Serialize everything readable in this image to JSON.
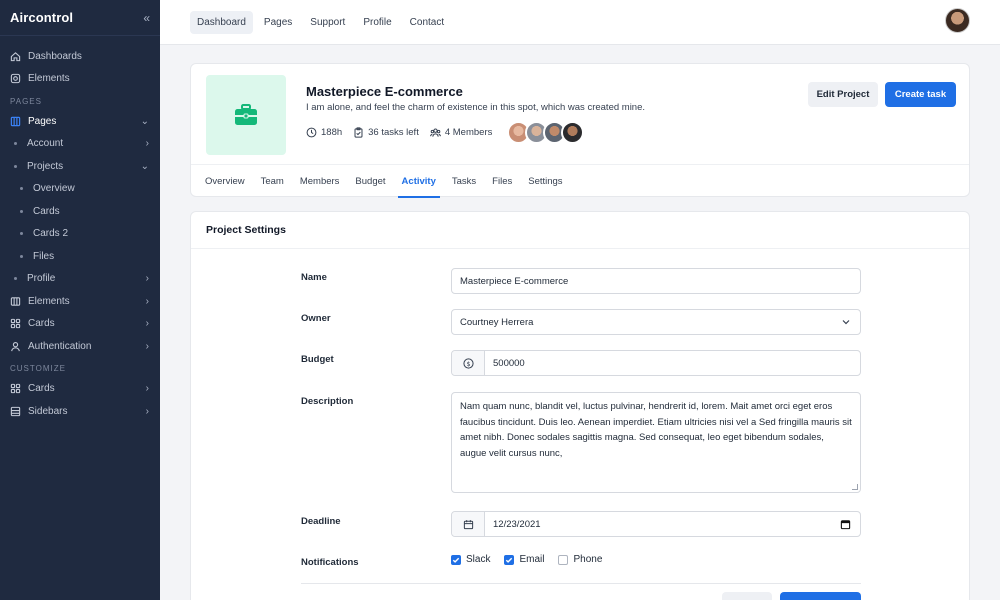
{
  "app": {
    "name": "Aircontrol",
    "collapse_icon": "double-chevron-left-icon"
  },
  "sidebar": {
    "sections": {
      "pages": "PAGES",
      "customize": "CUSTOMIZE"
    },
    "items": [
      {
        "label": "Dashboards",
        "icon": "home-icon"
      },
      {
        "label": "Elements",
        "icon": "settings-icon"
      },
      {
        "label": "Pages",
        "icon": "layout-icon"
      },
      {
        "label": "Account"
      },
      {
        "label": "Projects"
      },
      {
        "label": "Overview"
      },
      {
        "label": "Cards"
      },
      {
        "label": "Cards 2"
      },
      {
        "label": "Files"
      },
      {
        "label": "Profile"
      },
      {
        "label": "Elements",
        "icon": "columns-icon"
      },
      {
        "label": "Cards",
        "icon": "grid-icon"
      },
      {
        "label": "Authentication",
        "icon": "user-icon"
      },
      {
        "label": "Cards",
        "icon": "grid-icon"
      },
      {
        "label": "Sidebars",
        "icon": "sidebar-icon"
      }
    ]
  },
  "topnav": [
    "Dashboard",
    "Pages",
    "Support",
    "Profile",
    "Contact"
  ],
  "project": {
    "title": "Masterpiece E-commerce",
    "subtitle": "I am alone, and feel the charm of existence in this spot, which was created mine.",
    "hours": "188h",
    "tasks_left": "36 tasks left",
    "members": "4 Members",
    "edit_label": "Edit Project",
    "create_label": "Create task",
    "colors": {
      "accent": "#1f6fe5",
      "thumb_bg": "#dcf8ec",
      "icon": "#14b879"
    }
  },
  "tabs": [
    "Overview",
    "Team",
    "Members",
    "Budget",
    "Activity",
    "Tasks",
    "Files",
    "Settings"
  ],
  "active_tab": "Activity",
  "settings": {
    "title": "Project Settings",
    "name_label": "Name",
    "name_value": "Masterpiece E-commerce",
    "owner_label": "Owner",
    "owner_value": "Courtney Herrera",
    "budget_label": "Budget",
    "budget_value": "500000",
    "description_label": "Description",
    "description_value": "Nam quam nunc, blandit vel, luctus pulvinar, hendrerit id, lorem. Mait amet orci eget eros faucibus tincidunt. Duis leo. Aenean imperdiet. Etiam ultricies nisi vel a Sed fringilla mauris sit amet nibh. Donec sodales sagittis magna. Sed consequat, leo eget bibendum sodales, augue velit cursus nunc,",
    "deadline_label": "Deadline",
    "deadline_value": "12/23/2021",
    "notifications_label": "Notifications",
    "notifications": [
      {
        "label": "Slack",
        "checked": true
      },
      {
        "label": "Email",
        "checked": true
      },
      {
        "label": "Phone",
        "checked": false
      }
    ]
  }
}
